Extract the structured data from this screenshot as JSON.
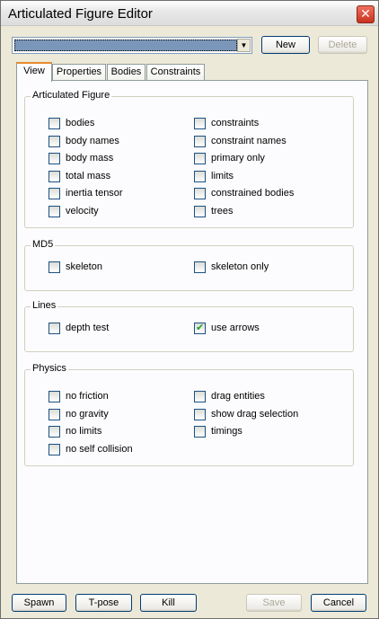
{
  "window": {
    "title": "Articulated Figure Editor",
    "close_glyph": "✕"
  },
  "toolbar": {
    "new_label": "New",
    "delete_label": "Delete"
  },
  "tabs": [
    {
      "label": "View",
      "active": true
    },
    {
      "label": "Properties",
      "active": false
    },
    {
      "label": "Bodies",
      "active": false
    },
    {
      "label": "Constraints",
      "active": false
    }
  ],
  "groups": {
    "articulated_figure": {
      "title": "Articulated Figure",
      "left": [
        {
          "label": "bodies",
          "checked": false
        },
        {
          "label": "body names",
          "checked": false
        },
        {
          "label": "body mass",
          "checked": false
        },
        {
          "label": "total mass",
          "checked": false
        },
        {
          "label": "inertia tensor",
          "checked": false
        },
        {
          "label": "velocity",
          "checked": false
        }
      ],
      "right": [
        {
          "label": "constraints",
          "checked": false
        },
        {
          "label": "constraint names",
          "checked": false
        },
        {
          "label": "primary only",
          "checked": false
        },
        {
          "label": "limits",
          "checked": false
        },
        {
          "label": "constrained bodies",
          "checked": false
        },
        {
          "label": "trees",
          "checked": false
        }
      ]
    },
    "md5": {
      "title": "MD5",
      "left": [
        {
          "label": "skeleton",
          "checked": false
        }
      ],
      "right": [
        {
          "label": "skeleton only",
          "checked": false
        }
      ]
    },
    "lines": {
      "title": "Lines",
      "left": [
        {
          "label": "depth test",
          "checked": false
        }
      ],
      "right": [
        {
          "label": "use arrows",
          "checked": true
        }
      ]
    },
    "physics": {
      "title": "Physics",
      "left": [
        {
          "label": "no friction",
          "checked": false
        },
        {
          "label": "no gravity",
          "checked": false
        },
        {
          "label": "no limits",
          "checked": false
        },
        {
          "label": "no self collision",
          "checked": false
        }
      ],
      "right": [
        {
          "label": "drag entities",
          "checked": false
        },
        {
          "label": "show drag selection",
          "checked": false
        },
        {
          "label": "timings",
          "checked": false
        }
      ]
    }
  },
  "footer": {
    "spawn_label": "Spawn",
    "tpose_label": "T-pose",
    "kill_label": "Kill",
    "save_label": "Save",
    "cancel_label": "Cancel"
  },
  "colors": {
    "accent": "#e68b2c",
    "close": "#c8321e",
    "check": "#21a121"
  }
}
